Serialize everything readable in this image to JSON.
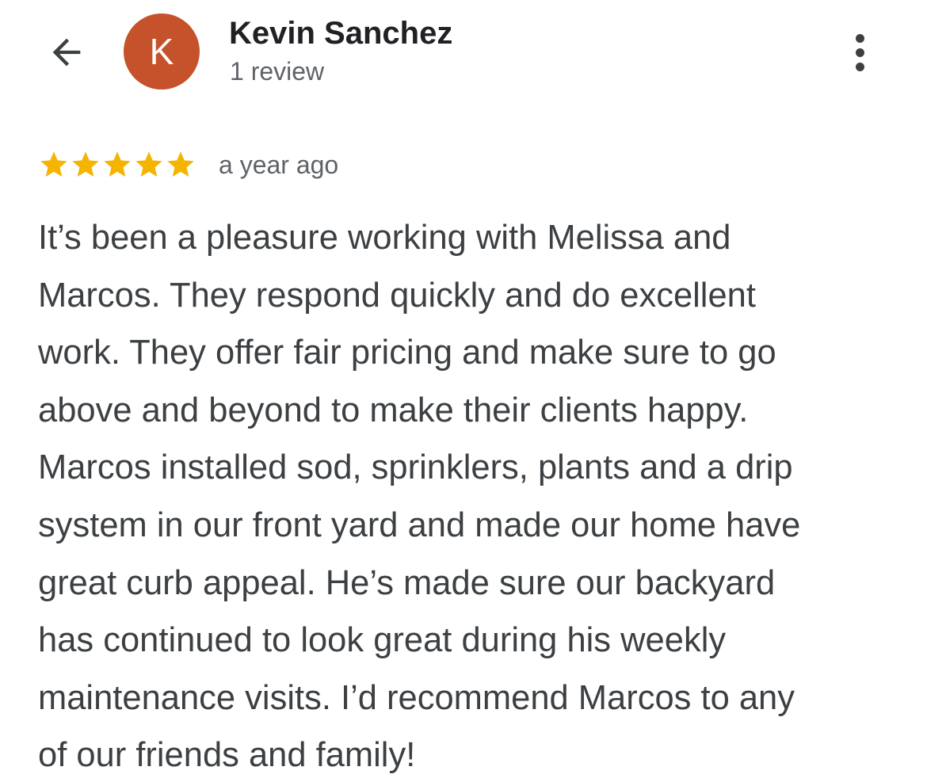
{
  "header": {
    "back_icon": "arrow-back-icon",
    "avatar_letter": "K",
    "avatar_color": "#c5522a",
    "author_name": "Kevin Sanchez",
    "author_meta": "1 review",
    "more_icon": "more-vert-icon"
  },
  "review": {
    "rating": 5,
    "rating_max": 5,
    "star_color": "#f4b400",
    "date": "a year ago",
    "lines": [
      "It’s been a pleasure working with Melissa and",
      "Marcos. They respond quickly and do excellent",
      "work. They offer fair pricing and make sure to go",
      "above and beyond to make their clients happy.",
      "Marcos installed sod, sprinklers, plants and a drip",
      "system in our front yard and made our home have",
      "great curb appeal. He’s made sure our backyard",
      "has continued to look great during his weekly",
      "maintenance visits. I’d recommend Marcos to any",
      "of our friends and family!"
    ]
  }
}
